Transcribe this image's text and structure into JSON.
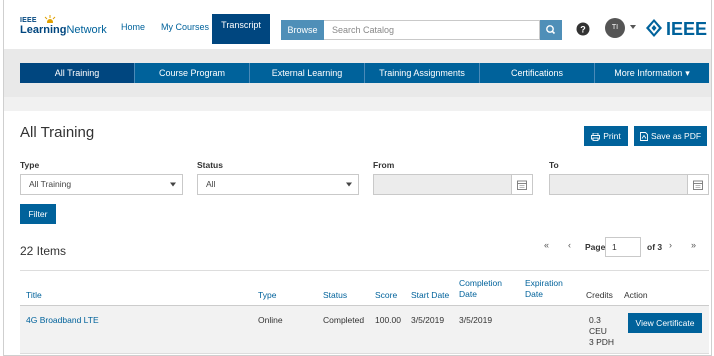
{
  "header": {
    "logo_line1": "IEEE",
    "logo_word1": "Learning",
    "logo_word2": "Network",
    "nav": [
      "Home",
      "My Courses",
      "Transcript"
    ],
    "browse_label": "Browse",
    "search_placeholder": "Search Catalog",
    "avatar_initials": "TI",
    "ieee_brand": "IEEE"
  },
  "tabs": [
    {
      "label": "All Training",
      "active": true
    },
    {
      "label": "Course Program"
    },
    {
      "label": "External Learning"
    },
    {
      "label": "Training Assignments"
    },
    {
      "label": "Certifications"
    },
    {
      "label": "More Information"
    }
  ],
  "page": {
    "title": "All Training",
    "print_label": "Print",
    "pdf_label": "Save as PDF"
  },
  "filters": {
    "type_label": "Type",
    "type_value": "All Training",
    "status_label": "Status",
    "status_value": "All",
    "from_label": "From",
    "to_label": "To",
    "filter_button": "Filter"
  },
  "list": {
    "count_text": "22 Items",
    "pager": {
      "first": "«",
      "prev": "‹",
      "page_label": "Page",
      "page_value": "1",
      "of_text": "of 3",
      "next": "›",
      "last": "»"
    }
  },
  "table": {
    "headers": {
      "title": "Title",
      "type": "Type",
      "status": "Status",
      "score": "Score",
      "start": "Start Date",
      "completion_1": "Completion",
      "completion_2": "Date",
      "expiration_1": "Expiration",
      "expiration_2": "Date",
      "credits": "Credits",
      "action": "Action"
    },
    "rows": [
      {
        "title": "4G Broadband LTE",
        "type": "Online",
        "status": "Completed",
        "score": "100.00",
        "start": "3/5/2019",
        "completion": "3/5/2019",
        "expiration": "",
        "credits_1": "0.3",
        "credits_2": "CEU",
        "credits_3": "3 PDH",
        "action": "View Certificate"
      }
    ]
  },
  "colors": {
    "primary": "#00629b",
    "primary_dark": "#00467f",
    "browse": "#4f8fb8"
  }
}
